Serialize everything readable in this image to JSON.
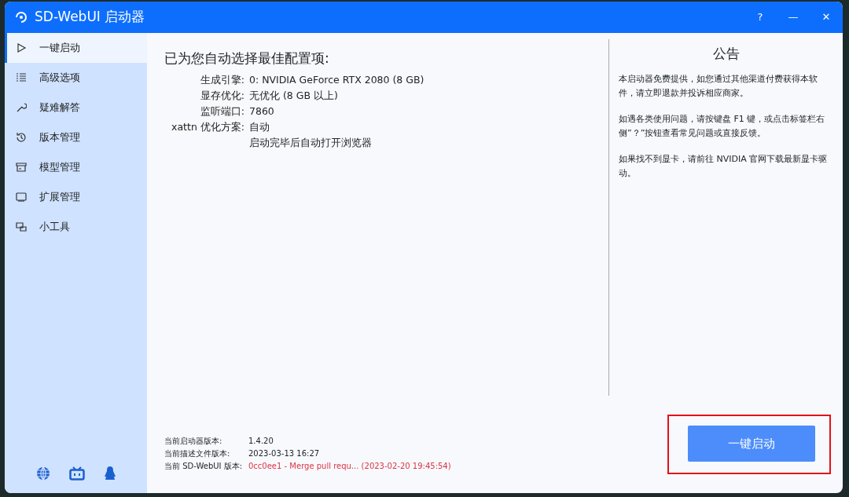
{
  "window": {
    "title": "SD-WebUI 启动器",
    "controls": [
      "?",
      "—",
      "✕"
    ]
  },
  "sidebar": {
    "items": [
      {
        "label": "一键启动",
        "selected": true
      },
      {
        "label": "高级选项",
        "selected": false
      },
      {
        "label": "疑难解答",
        "selected": false
      },
      {
        "label": "版本管理",
        "selected": false
      },
      {
        "label": "模型管理",
        "selected": false
      },
      {
        "label": "扩展管理",
        "selected": false
      },
      {
        "label": "小工具",
        "selected": false
      }
    ]
  },
  "config": {
    "heading": "已为您自动选择最佳配置项:",
    "rows": [
      {
        "label": "生成引擎:",
        "value": "0: NVIDIA GeForce RTX 2080 (8 GB)"
      },
      {
        "label": "显存优化:",
        "value": "无优化 (8 GB 以上)"
      },
      {
        "label": "监听端口:",
        "value": "7860"
      },
      {
        "label": "xattn 优化方案:",
        "value": "自动"
      },
      {
        "value": "启动完毕后自动打开浏览器"
      }
    ]
  },
  "versions": [
    {
      "label": "当前启动器版本:",
      "value": "1.4.20",
      "highlighted": false
    },
    {
      "label": "当前描述文件版本:",
      "value": "2023-03-13 16:27",
      "highlighted": false
    },
    {
      "label": "当前 SD-WebUI 版本:",
      "value": "0cc0ee1 - Merge pull requ... (2023-02-20 19:45:54)",
      "highlighted": true
    }
  ],
  "notice": {
    "title": "公告",
    "paragraphs": [
      "本启动器免费提供，如您通过其他渠道付费获得本软件，请立即退款并投诉相应商家。",
      "如遇各类使用问题，请按键盘 F1 键，或点击标签栏右侧”？”按钮查看常见问题或直接反馈。",
      "如果找不到显卡，请前往 NVIDIA 官网下载最新显卡驱动。"
    ]
  },
  "start_button": {
    "label": "一键启动",
    "annotated": true
  }
}
